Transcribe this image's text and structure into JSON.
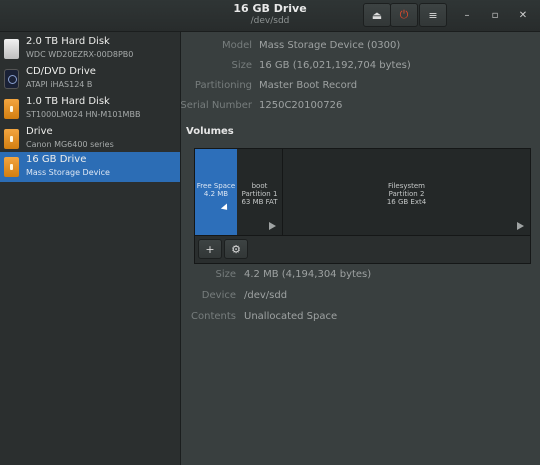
{
  "window": {
    "title": "16 GB Drive",
    "subtitle": "/dev/sdd"
  },
  "header_buttons": [
    {
      "name": "eject-icon",
      "glyph": "⏏"
    },
    {
      "name": "power-icon",
      "glyph": "⏻",
      "color": "#e04a2c"
    },
    {
      "name": "menu-icon",
      "glyph": "≡"
    }
  ],
  "window_controls": {
    "minimize": "–",
    "maximize": "▫",
    "close": "✕"
  },
  "devices": [
    {
      "title": "2.0 TB Hard Disk",
      "subtitle": "WDC WD20EZRX-00D8PB0",
      "icon": "drive-icon"
    },
    {
      "title": "CD/DVD Drive",
      "subtitle": "ATAPI iHAS124 B",
      "icon": "optical-drive-icon"
    },
    {
      "title": "1.0 TB Hard Disk",
      "subtitle": "ST1000LM024 HN-M101MBB",
      "icon": "hard-disk-icon"
    },
    {
      "title": "Drive",
      "subtitle": "Canon MG6400 series",
      "icon": "drive-icon"
    },
    {
      "title": "16 GB Drive",
      "subtitle": "Mass Storage Device",
      "icon": "usb-drive-icon",
      "selected": true
    }
  ],
  "drive_info": {
    "model_label": "Model",
    "model_value": "Mass Storage Device (0300)",
    "size_label": "Size",
    "size_value": "16 GB (16,021,192,704 bytes)",
    "partitioning_label": "Partitioning",
    "partitioning_value": "Master Boot Record",
    "serial_label": "Serial Number",
    "serial_value": "1250C20100726"
  },
  "volumes": {
    "heading": "Volumes",
    "segments": [
      {
        "l1": "Free Space",
        "l2": "4.2 MB",
        "l3": ""
      },
      {
        "l1": "boot",
        "l2": "Partition 1",
        "l3": "63 MB FAT"
      },
      {
        "l1": "Filesystem",
        "l2": "Partition 2",
        "l3": "16 GB Ext4"
      }
    ],
    "toolbar": {
      "add": "+",
      "settings": "⚙"
    }
  },
  "selected_volume": {
    "size_label": "Size",
    "size_value": "4.2 MB (4,194,304 bytes)",
    "device_label": "Device",
    "device_value": "/dev/sdd",
    "contents_label": "Contents",
    "contents_value": "Unallocated Space"
  },
  "colors": {
    "accent": "#2c6db5",
    "background": "#393f3f",
    "sidebar": "#2b2f2f"
  }
}
